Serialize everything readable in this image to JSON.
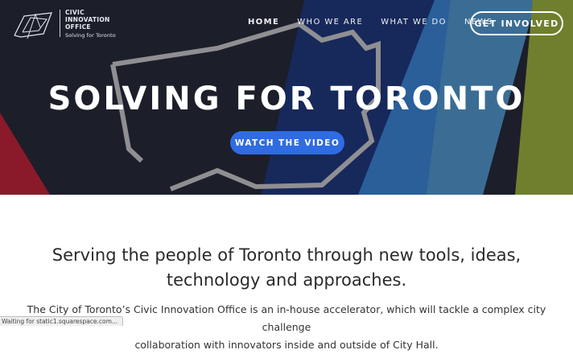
{
  "logo": {
    "line1": "CIVIC",
    "line2": "INNOVATION",
    "line3": "OFFICE",
    "tagline": "Solving for Toronto"
  },
  "nav": {
    "items": [
      "HOME",
      "WHO WE ARE",
      "WHAT WE DO",
      "NEWS"
    ],
    "cta": "GET INVOLVED"
  },
  "hero": {
    "title": "SOLVING FOR TORONTO",
    "button": "WATCH THE VIDEO"
  },
  "content": {
    "headline_line1": "Serving the people of Toronto through new tools, ideas,",
    "headline_line2": "technology and approaches.",
    "body_line1": "The City of Toronto’s Civic Innovation Office is an in-house accelerator, which will tackle a complex city challenge",
    "body_line2": "collaboration with innovators inside and outside of City Hall."
  },
  "status_bar": {
    "text": "Waiting for static1.squarespace.com..."
  },
  "colors": {
    "hero_dark": "#1c1e2a",
    "navy": "#17285a",
    "blue": "#2a5f9a",
    "steel": "#3b6d94",
    "olive": "#6f7f2e",
    "red": "#8a1a2a",
    "button_blue": "#2f6be3"
  }
}
